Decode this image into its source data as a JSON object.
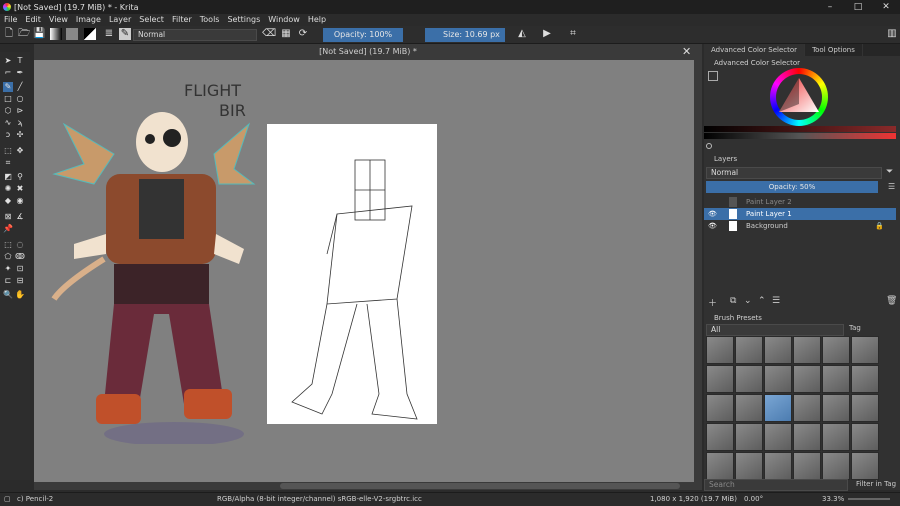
{
  "window": {
    "title": "[Not Saved]  (19.7 MiB) * - Krita",
    "minimize": "–",
    "maximize": "□",
    "close": "✕"
  },
  "menu": [
    "File",
    "Edit",
    "View",
    "Image",
    "Layer",
    "Select",
    "Filter",
    "Tools",
    "Settings",
    "Window",
    "Help"
  ],
  "toolbar": {
    "blend_mode": "Normal",
    "opacity": "Opacity: 100%",
    "size": "Size: 10.69 px"
  },
  "canvas": {
    "doc_title": "[Not Saved]  (19.7 MiB) *",
    "close": "✕",
    "art_text": "FLIGHT\nBIR"
  },
  "dock_tabs": [
    "Advanced Color Selector",
    "Tool Options"
  ],
  "color_selector": {
    "title": "Advanced Color Selector"
  },
  "layers": {
    "title": "Layers",
    "blend_mode": "Normal",
    "opacity": "Opacity:  50%",
    "items": [
      {
        "name": "Paint Layer 2",
        "selected": false
      },
      {
        "name": "Paint Layer 1",
        "selected": true
      },
      {
        "name": "Background",
        "selected": false
      }
    ]
  },
  "brush_presets": {
    "title": "Brush Presets",
    "filter": "All",
    "tag": "Tag",
    "search_placeholder": "Search",
    "filter_in_tag": "Filter in Tag"
  },
  "status": {
    "brush": "c) Pencil-2",
    "color_space": "RGB/Alpha (8-bit integer/channel)  sRGB-elle-V2-srgbtrc.icc",
    "dimensions": "1,080 x 1,920 (19.7 MiB)",
    "rotation": "0.00°",
    "zoom": "33.3%"
  },
  "colors": {
    "accent": "#3b6fa8",
    "bg": "#2b2b2b",
    "canvas_bg": "#808080"
  }
}
